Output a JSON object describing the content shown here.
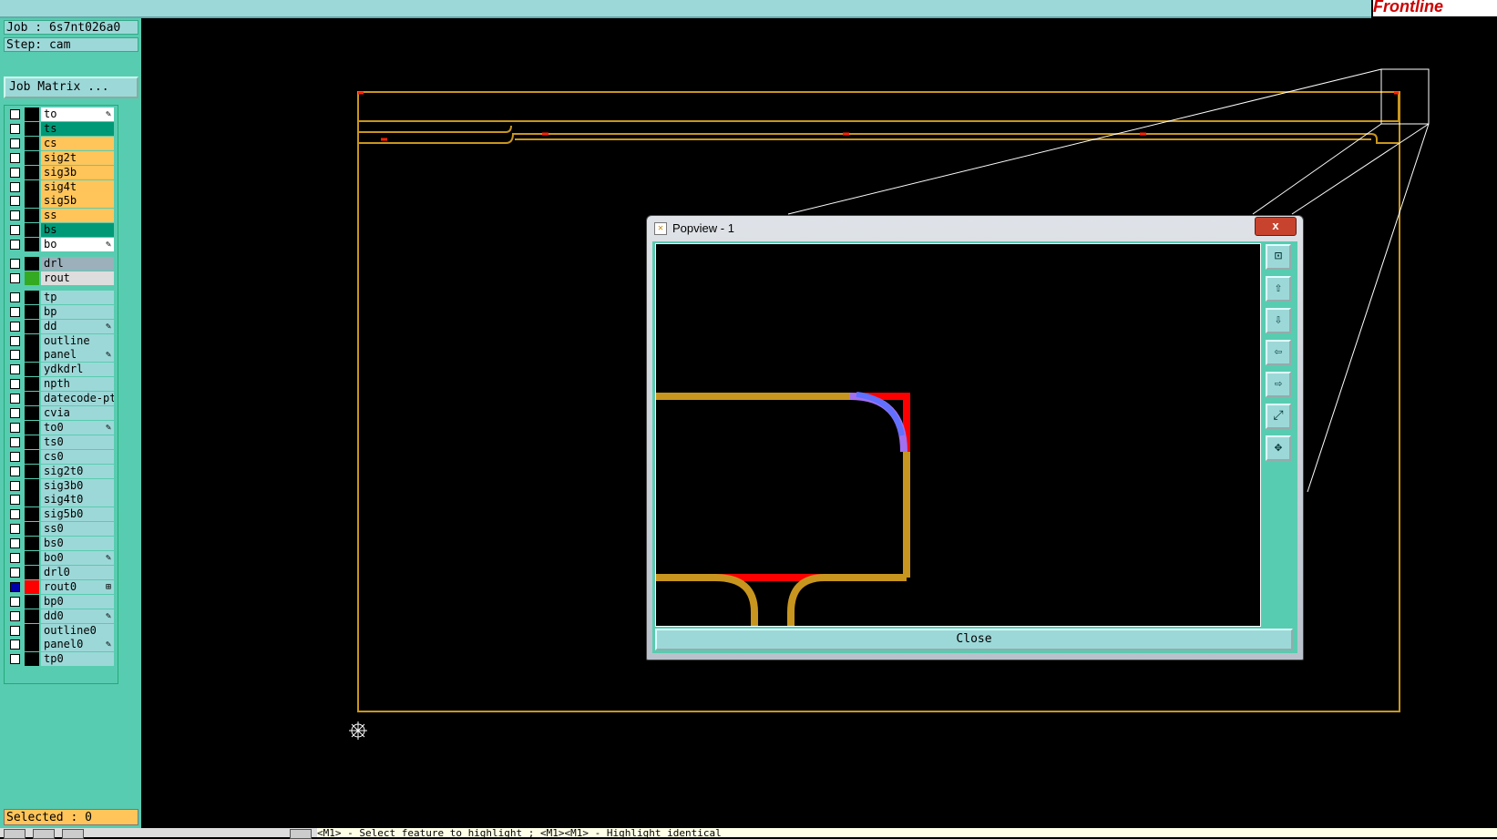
{
  "brand": "Frontline",
  "job": "Job : 6s7nt026a0",
  "step": "Step: cam",
  "job_matrix": "Job Matrix ...",
  "selected": "Selected : 0",
  "status_message": "<M1> - Select feature to highlight ; <M1><M1> - Highlight identical",
  "popup": {
    "title": "Popview - 1",
    "close_x": "x",
    "close_button": "Close"
  },
  "colors": {
    "orange": "#ffc55a",
    "green": "#009977",
    "white": "#ffffff",
    "cyan": "#9dd8d8",
    "gray": "#9bb0bb",
    "grayalt": "#dddddd",
    "board": "#c8961e",
    "red": "#ff0000"
  },
  "layers": [
    {
      "name": "to",
      "color": "white",
      "mark": "✎"
    },
    {
      "name": "ts",
      "color": "green",
      "mark": ""
    },
    {
      "name": "cs",
      "color": "orange",
      "mark": ""
    },
    {
      "name": "sig2t",
      "color": "orange",
      "mark": ""
    },
    {
      "name": "sig3b",
      "color": "orange",
      "mark": ""
    },
    {
      "name": "sig4t",
      "color": "orange",
      "mark": ""
    },
    {
      "name": "sig5b",
      "color": "orange",
      "mark": ""
    },
    {
      "name": "ss",
      "color": "orange",
      "mark": ""
    },
    {
      "name": "bs",
      "color": "green",
      "mark": ""
    },
    {
      "name": "bo",
      "color": "white",
      "mark": "✎"
    },
    {
      "name": "drl",
      "color": "gray",
      "mark": ""
    },
    {
      "name": "rout",
      "color": "grayalt",
      "mark": "",
      "swatch": "#33aa22"
    },
    {
      "name": "tp",
      "color": "cyan",
      "mark": ""
    },
    {
      "name": "bp",
      "color": "cyan",
      "mark": ""
    },
    {
      "name": "dd",
      "color": "cyan",
      "mark": "✎"
    },
    {
      "name": "outline",
      "color": "cyan",
      "mark": ""
    },
    {
      "name": "panel",
      "color": "cyan",
      "mark": "✎"
    },
    {
      "name": "ydkdrl",
      "color": "cyan",
      "mark": ""
    },
    {
      "name": "npth",
      "color": "cyan",
      "mark": ""
    },
    {
      "name": "datecode-pte",
      "color": "cyan",
      "mark": ""
    },
    {
      "name": "cvia",
      "color": "cyan",
      "mark": ""
    },
    {
      "name": "to0",
      "color": "cyan",
      "mark": "✎"
    },
    {
      "name": "ts0",
      "color": "cyan",
      "mark": ""
    },
    {
      "name": "cs0",
      "color": "cyan",
      "mark": ""
    },
    {
      "name": "sig2t0",
      "color": "cyan",
      "mark": ""
    },
    {
      "name": "sig3b0",
      "color": "cyan",
      "mark": ""
    },
    {
      "name": "sig4t0",
      "color": "cyan",
      "mark": ""
    },
    {
      "name": "sig5b0",
      "color": "cyan",
      "mark": ""
    },
    {
      "name": "ss0",
      "color": "cyan",
      "mark": ""
    },
    {
      "name": "bs0",
      "color": "cyan",
      "mark": ""
    },
    {
      "name": "bo0",
      "color": "cyan",
      "mark": "✎"
    },
    {
      "name": "drl0",
      "color": "cyan",
      "mark": ""
    },
    {
      "name": "rout0",
      "color": "cyan",
      "mark": "⊞",
      "swatch": "#ff0000",
      "active": true
    },
    {
      "name": "bp0",
      "color": "cyan",
      "mark": ""
    },
    {
      "name": "dd0",
      "color": "cyan",
      "mark": "✎"
    },
    {
      "name": "outline0",
      "color": "cyan",
      "mark": ""
    },
    {
      "name": "panel0",
      "color": "cyan",
      "mark": "✎"
    },
    {
      "name": "tp0",
      "color": "cyan",
      "mark": ""
    }
  ],
  "tools": [
    "zoom-window-icon",
    "pan-up-icon",
    "pan-down-icon",
    "pan-left-icon",
    "pan-right-icon",
    "zoom-home-icon",
    "zoom-fit-icon"
  ]
}
